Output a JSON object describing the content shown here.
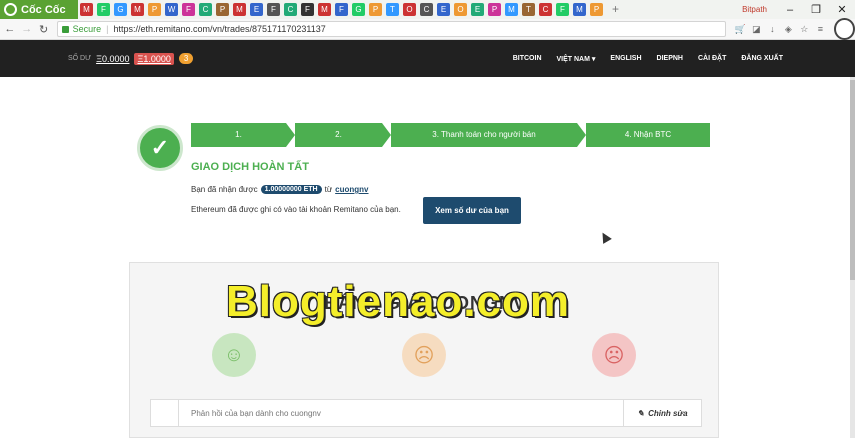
{
  "browser": {
    "brand": "Cốc Cốc",
    "secure_label": "Secure",
    "url": "https://eth.remitano.com/vn/trades/875171170231137",
    "profile_label": "Bitpath",
    "tab_icons": [
      "M",
      "F",
      "G",
      "M",
      "P",
      "W",
      "F",
      "C",
      "P",
      "M",
      "E",
      "F",
      "C",
      "F",
      "M",
      "F",
      "G",
      "P",
      "T",
      "O",
      "C",
      "E",
      "O",
      "E",
      "P",
      "M",
      "T",
      "C",
      "F",
      "M",
      "P"
    ],
    "colors": {
      "tab_accent": "#5aa232"
    }
  },
  "header": {
    "balance_label": "SỐ DƯ",
    "balance_eth": "Ξ0.0000",
    "balance_locked": "Ξ1.0000",
    "notification_count": "3",
    "menu": {
      "bitcoin": "BITCOIN",
      "country": "VIỆT NAM ▾",
      "language": "ENGLISH",
      "user": "DIEPNH",
      "settings": "CÀI ĐẶT",
      "logout": "ĐĂNG XUẤT"
    }
  },
  "steps": [
    {
      "label": "1."
    },
    {
      "label": "2."
    },
    {
      "label": "3. Thanh toán cho người bán"
    },
    {
      "label": "4. Nhận BTC"
    }
  ],
  "trade": {
    "status_title": "GIAO DỊCH HOÀN TẤT",
    "received_prefix": "Bạn đã nhận được",
    "amount": "1.00000000 ETH",
    "from_label": "từ",
    "counterparty": "cuongnv",
    "credited_text": "Ethereum đã được ghi có vào tài khoản Remitano của bạn.",
    "view_balance_button": "Xem số dư của bạn",
    "colors": {
      "success": "#4caf50",
      "primary": "#1e4b6e"
    }
  },
  "feedback": {
    "title": "ĐÁNH GIÁ CUONGNV",
    "input_placeholder": "Phản hồi của bạn dành cho cuongnv",
    "edit_button": "Chỉnh sửa"
  },
  "watermark": "Blogtienao.com"
}
